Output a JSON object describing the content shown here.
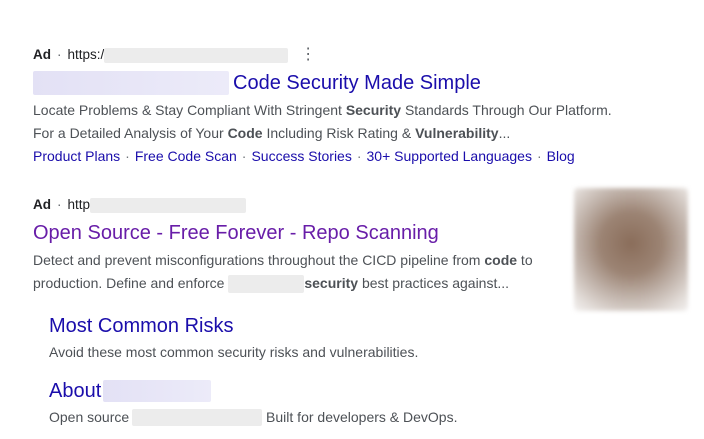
{
  "ads": [
    {
      "ad_label": "Ad",
      "separator": "·",
      "url_prefix": "https:/",
      "menu_icon": "⋮",
      "title": "Code Security Made Simple",
      "desc_line1": {
        "a": "Locate Problems & Stay Compliant With Stringent ",
        "b1": "Security",
        "c": " Standards Through Our Platform."
      },
      "desc_line2": {
        "a": "For a Detailed Analysis of Your ",
        "b1": "Code",
        "c": " Including Risk Rating & ",
        "b2": "Vulnerability",
        "d": "..."
      },
      "sitelinks": [
        "Product Plans",
        "Free Code Scan",
        "Success Stories",
        "30+ Supported Languages",
        "Blog"
      ],
      "sitelink_separator": "·"
    },
    {
      "ad_label": "Ad",
      "separator": "·",
      "url_prefix": "http",
      "title": "Open Source - Free Forever - Repo Scanning",
      "desc_line1": {
        "a": "Detect and prevent misconfigurations throughout the CICD pipeline from ",
        "b1": "code",
        "c": " to"
      },
      "desc_line2": {
        "a": "production. Define and enforce ",
        "b1": "security",
        "c": " best practices against..."
      }
    }
  ],
  "sub_results": [
    {
      "title": "Most Common Risks",
      "desc": "Avoid these most common security risks and vulnerabilities."
    },
    {
      "title": "About",
      "desc_a": "Open source",
      "desc_b": " Built for developers & DevOps."
    }
  ]
}
